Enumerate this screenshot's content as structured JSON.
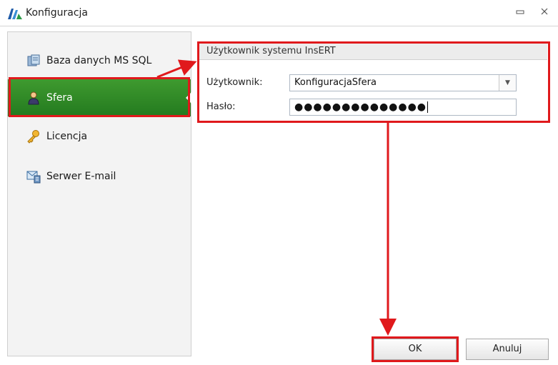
{
  "window": {
    "title": "Konfiguracja"
  },
  "sidebar": {
    "items": [
      {
        "label": "Baza danych MS SQL",
        "icon": "database-icon"
      },
      {
        "label": "Sfera",
        "icon": "user-icon",
        "active": true
      },
      {
        "label": "Licencja",
        "icon": "key-icon"
      },
      {
        "label": "Serwer E-mail",
        "icon": "email-server-icon"
      }
    ]
  },
  "group": {
    "title": "Użytkownik systemu InsERT",
    "user_label": "Użytkownik:",
    "user_value": "KonfiguracjaSfera",
    "password_label": "Hasło:",
    "password_value": "●●●●●●●●●●●●●●"
  },
  "buttons": {
    "ok": "OK",
    "cancel": "Anuluj"
  },
  "colors": {
    "active_green": "#2f8a26",
    "highlight_red": "#e0191c"
  }
}
